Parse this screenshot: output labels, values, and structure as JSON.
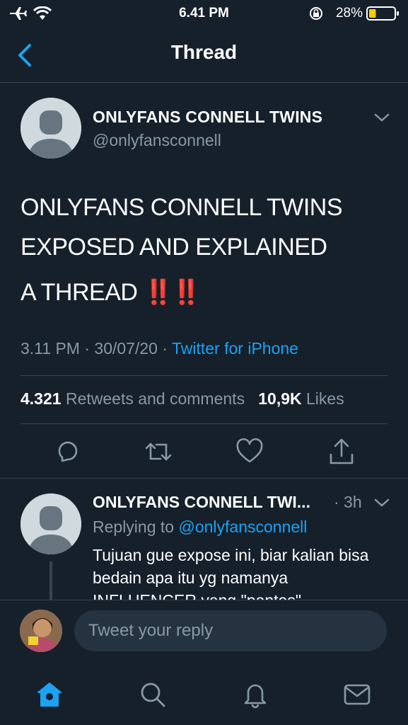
{
  "status_bar": {
    "time": "6.41 PM",
    "battery_percent": "28%",
    "battery_level": 0.28,
    "icons": [
      "airplane-icon",
      "wifi-icon",
      "rotation-lock-icon",
      "battery-icon"
    ]
  },
  "nav": {
    "title": "Thread",
    "back_icon": "chevron-left-icon"
  },
  "tweet": {
    "author_name": "ONLYFANS CONNELL TWINS",
    "author_handle": "@onlyfansconnell",
    "text_line1": "ONLYFANS CONNELL TWINS",
    "text_line2": "EXPOSED AND EXPLAINED",
    "text_line3": "A THREAD",
    "text_emoji": "‼️‼️",
    "time": "3.11 PM",
    "dot1": "·",
    "date": "30/07/20",
    "dot2": "·",
    "source": "Twitter for iPhone",
    "retweets_count": "4.321",
    "retweets_label": "Retweets and comments",
    "likes_count": "10,9K",
    "likes_label": "Likes"
  },
  "actions": [
    "reply-icon",
    "retweet-icon",
    "like-icon",
    "share-icon"
  ],
  "reply_tweet": {
    "author_name": "ONLYFANS CONNELL TWI...",
    "time": "· 3h",
    "replying_label": "Replying to",
    "replying_handle": "@onlyfansconnell",
    "text": "Tujuan gue expose ini, biar kalian bisa bedain apa itu yg namanya INFLUENCER yang \"pantes\""
  },
  "compose": {
    "placeholder": "Tweet your reply"
  },
  "tabbar": {
    "tabs": [
      "home-icon",
      "search-icon",
      "notifications-icon",
      "messages-icon"
    ],
    "active_color": "#1da1f2",
    "inactive_color": "#8899a6"
  },
  "colors": {
    "background": "#15202b",
    "accent": "#1da1f2",
    "secondary_text": "#8899a6",
    "divider": "#38444d",
    "emoji_red": "#e0245e"
  }
}
